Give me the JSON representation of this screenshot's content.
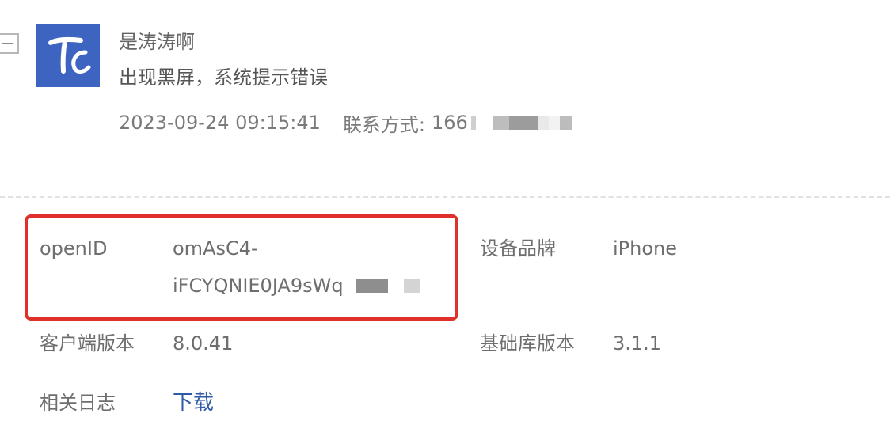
{
  "feedback": {
    "user_name": "是涛涛啊",
    "message": "出现黑屏，系统提示错误",
    "timestamp": "2023-09-24 09:15:41",
    "contact_label": "联系方式:",
    "contact_value_visible": "166"
  },
  "avatar": {
    "letters": "Tc",
    "background": "#3c64c0"
  },
  "details": {
    "openid": {
      "label": "openID",
      "value_line1": "omAsC4-",
      "value_line2": "iFCYQNIE0JA9sWq"
    },
    "device_brand": {
      "label": "设备品牌",
      "value": "iPhone"
    },
    "client_version": {
      "label": "客户端版本",
      "value": "8.0.41"
    },
    "base_library_version": {
      "label": "基础库版本",
      "value": "3.1.1"
    },
    "related_logs": {
      "label": "相关日志",
      "link": "下载"
    }
  },
  "colors": {
    "highlight_border": "#e0302a",
    "link": "#2f5aa8",
    "text": "#6e6e6e"
  },
  "icons": {
    "collapse_toggle": "minus-square-icon"
  }
}
